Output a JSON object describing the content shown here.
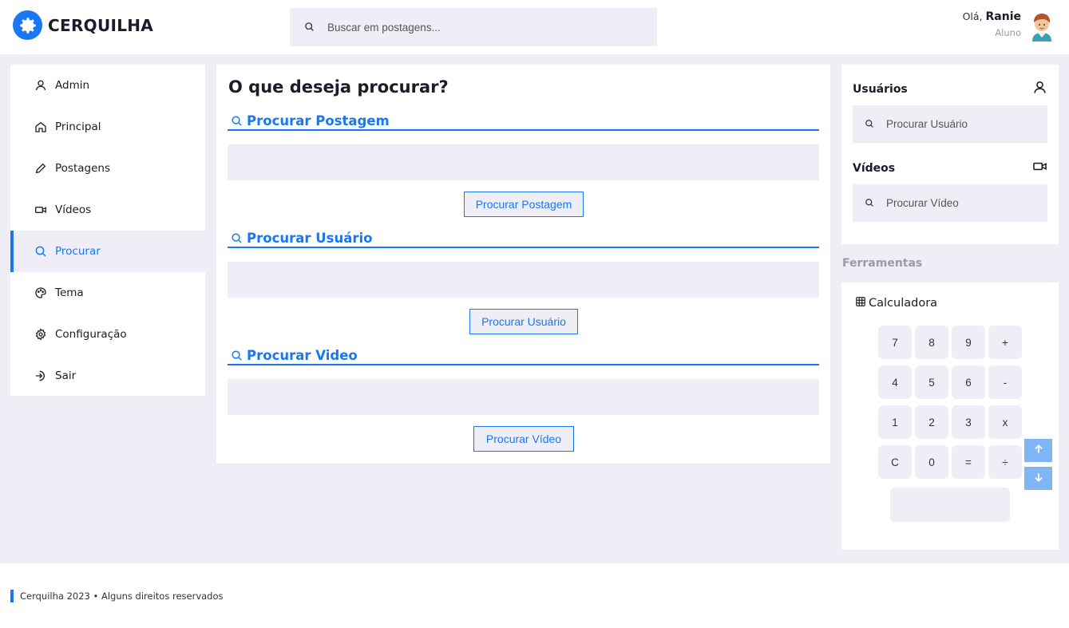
{
  "brand": {
    "name": "CERQUILHA",
    "accent": "#1877f2"
  },
  "top_search": {
    "placeholder": "Buscar em postagens..."
  },
  "user": {
    "greeting": "Olá,",
    "name": "Ranie",
    "role": "Aluno"
  },
  "sidebar": {
    "items": [
      {
        "label": "Admin",
        "icon": "user-icon"
      },
      {
        "label": "Principal",
        "icon": "home-icon"
      },
      {
        "label": "Postagens",
        "icon": "pencil-icon"
      },
      {
        "label": "Vídeos",
        "icon": "video-icon"
      },
      {
        "label": "Procurar",
        "icon": "search-icon",
        "active": true
      },
      {
        "label": "Tema",
        "icon": "palette-icon"
      },
      {
        "label": "Configuração",
        "icon": "gear-icon"
      },
      {
        "label": "Sair",
        "icon": "logout-icon"
      }
    ]
  },
  "main": {
    "title": "O que deseja procurar?",
    "sections": [
      {
        "title": "Procurar Postagem",
        "button": "Procurar Postagem"
      },
      {
        "title": "Procurar Usuário",
        "button": "Procurar Usuário"
      },
      {
        "title": "Procurar Video",
        "button": "Procurar Vídeo"
      }
    ]
  },
  "right": {
    "users": {
      "title": "Usuários",
      "placeholder": "Procurar Usuário"
    },
    "videos": {
      "title": "Vídeos",
      "placeholder": "Procurar Vídeo"
    },
    "tools_label": "Ferramentas",
    "calculator": {
      "title": "Calculadora",
      "keys": [
        [
          "7",
          "8",
          "9",
          "+"
        ],
        [
          "4",
          "5",
          "6",
          "-"
        ],
        [
          "1",
          "2",
          "3",
          "x"
        ],
        [
          "C",
          "0",
          "=",
          "÷"
        ]
      ]
    }
  },
  "footer": {
    "text": "Cerquilha 2023 • Alguns direitos reservados"
  }
}
